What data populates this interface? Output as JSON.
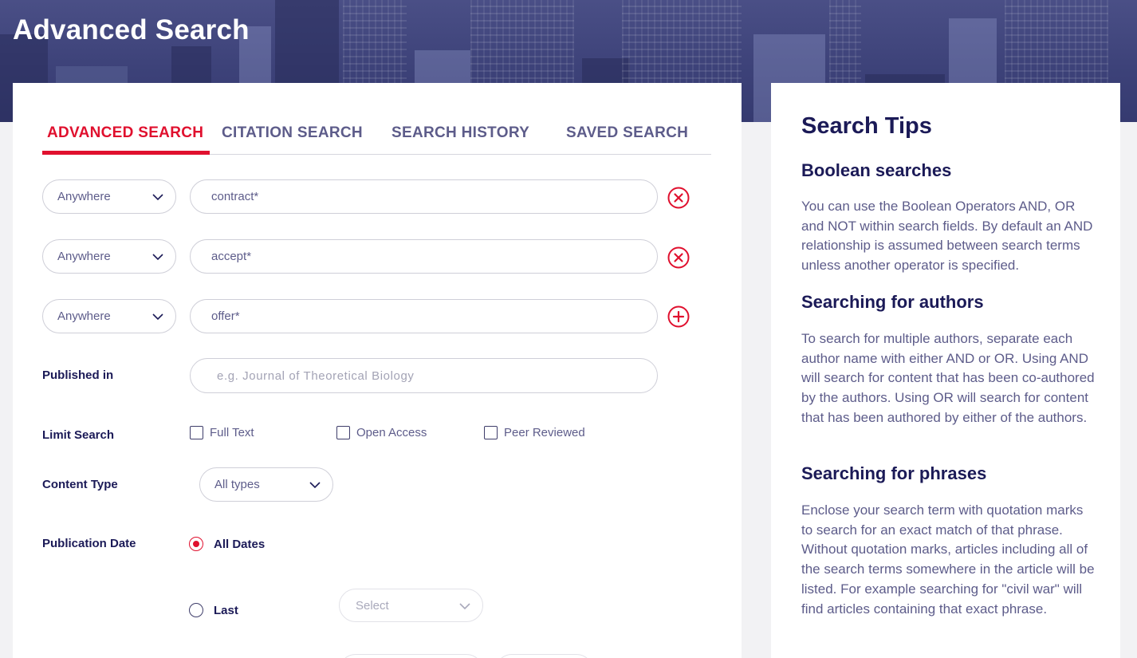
{
  "page": {
    "title": "Advanced Search"
  },
  "tabs": [
    {
      "label": "ADVANCED SEARCH",
      "active": true
    },
    {
      "label": "CITATION SEARCH",
      "active": false
    },
    {
      "label": "SEARCH HISTORY",
      "active": false
    },
    {
      "label": "SAVED SEARCH",
      "active": false
    }
  ],
  "search_rows": [
    {
      "field": "Anywhere",
      "value": "contract*",
      "action": "remove"
    },
    {
      "field": "Anywhere",
      "value": "accept*",
      "action": "remove"
    },
    {
      "field": "Anywhere",
      "value": "offer*",
      "action": "add"
    }
  ],
  "published_in": {
    "label": "Published in",
    "placeholder": "e.g. Journal of Theoretical Biology"
  },
  "limit_search": {
    "label": "Limit Search",
    "options": [
      {
        "label": "Full Text",
        "checked": false
      },
      {
        "label": "Open Access",
        "checked": false
      },
      {
        "label": "Peer Reviewed",
        "checked": false
      }
    ]
  },
  "content_type": {
    "label": "Content Type",
    "value": "All types"
  },
  "publication_date": {
    "label": "Publication Date",
    "options": [
      {
        "label": "All Dates",
        "selected": true
      },
      {
        "label": "Last",
        "selected": false
      }
    ],
    "last_select": "Select"
  },
  "tips": {
    "title": "Search Tips",
    "sections": [
      {
        "heading": "Boolean searches",
        "body": "You can use the Boolean Operators AND, OR and NOT within search fields. By default an AND relationship is assumed between search terms unless another operator is specified."
      },
      {
        "heading": "Searching for authors",
        "body": "To search for multiple authors, separate each author name with either AND or OR. Using AND will search for content that has been co-authored by the authors. Using OR will search for content that has been authored by either of the authors."
      },
      {
        "heading": "Searching for phrases",
        "body": "Enclose your search term with quotation marks to search for an exact match of that phrase. Without quotation marks, articles including all of the search terms somewhere in the article will be listed. For example searching for \"civil war\" will find articles containing that exact phrase."
      }
    ]
  },
  "colors": {
    "accent": "#e0102e",
    "navy": "#1b1a57",
    "muted": "#5d5c8a"
  }
}
